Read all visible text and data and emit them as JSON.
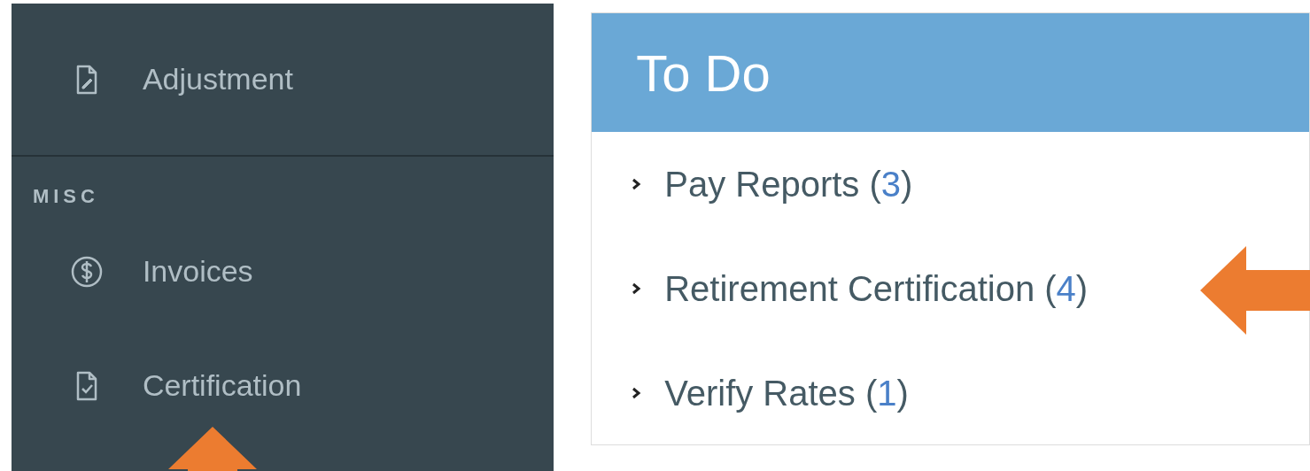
{
  "sidebar": {
    "sections": [
      {
        "items": [
          {
            "label": "Adjustment",
            "kind": "edit"
          }
        ]
      },
      {
        "heading": "MISC",
        "items": [
          {
            "label": "Invoices",
            "kind": "money"
          },
          {
            "label": "Certification",
            "kind": "check"
          }
        ]
      }
    ]
  },
  "todo": {
    "title": "To Do",
    "items": [
      {
        "label": "Pay Reports",
        "open": "(",
        "count": "3",
        "close": ")"
      },
      {
        "label": "Retirement Certification",
        "open": "(",
        "count": "4",
        "close": ")"
      },
      {
        "label": "Verify Rates",
        "open": "(",
        "count": "1",
        "close": ")"
      }
    ]
  }
}
